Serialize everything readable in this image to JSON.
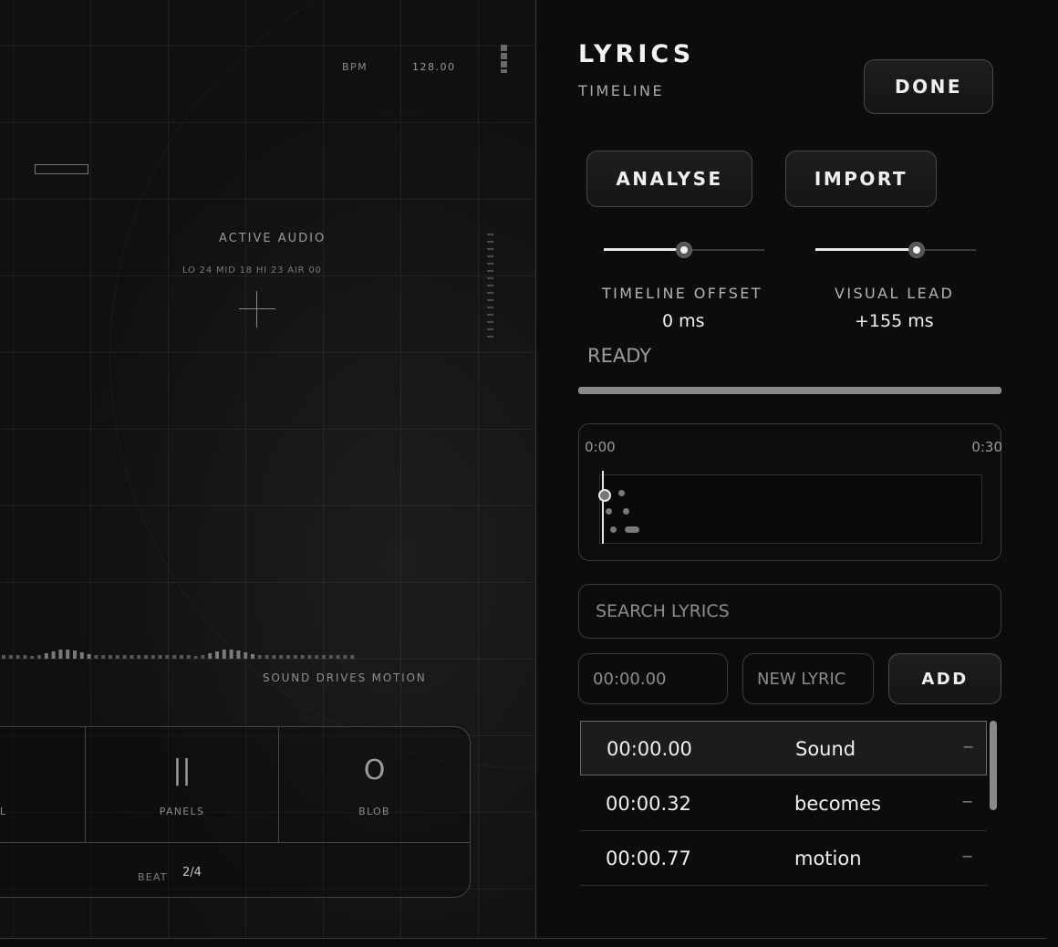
{
  "visualizer": {
    "bpm_label": "BPM",
    "bpm_value": "128.00",
    "active_audio": "ACTIVE AUDIO",
    "bands": "LO 24 MID 18 HI 23 AIR 00",
    "tagline": "SOUND DRIVES MOTION",
    "modes": [
      {
        "glyph": "",
        "label": "AL"
      },
      {
        "glyph": "||",
        "label": "PANELS"
      },
      {
        "glyph": "O",
        "label": "BLOB"
      }
    ],
    "beat_label": "BEAT",
    "beat_value": "2/4"
  },
  "panel": {
    "title": "LYRICS",
    "subtitle": "TIMELINE",
    "done_label": "DONE",
    "analyse_label": "ANALYSE",
    "import_label": "IMPORT",
    "timeline_offset": {
      "label": "TIMELINE OFFSET",
      "value": "0 ms",
      "level": 0.5
    },
    "visual_lead": {
      "label": "VISUAL LEAD",
      "value": "+155 ms",
      "level": 0.63
    },
    "status": "READY",
    "progress": 1.0
  },
  "timeline": {
    "start": "0:00",
    "end": "0:30"
  },
  "search": {
    "placeholder": "SEARCH LYRICS"
  },
  "add_form": {
    "time_placeholder": "00:00.00",
    "lyric_placeholder": "NEW LYRIC",
    "add_label": "ADD"
  },
  "lyrics": [
    {
      "time": "00:00.00",
      "word": "Sound",
      "remove": "−",
      "selected": true
    },
    {
      "time": "00:00.32",
      "word": "becomes",
      "remove": "−",
      "selected": false
    },
    {
      "time": "00:00.77",
      "word": "motion",
      "remove": "−",
      "selected": false
    }
  ]
}
